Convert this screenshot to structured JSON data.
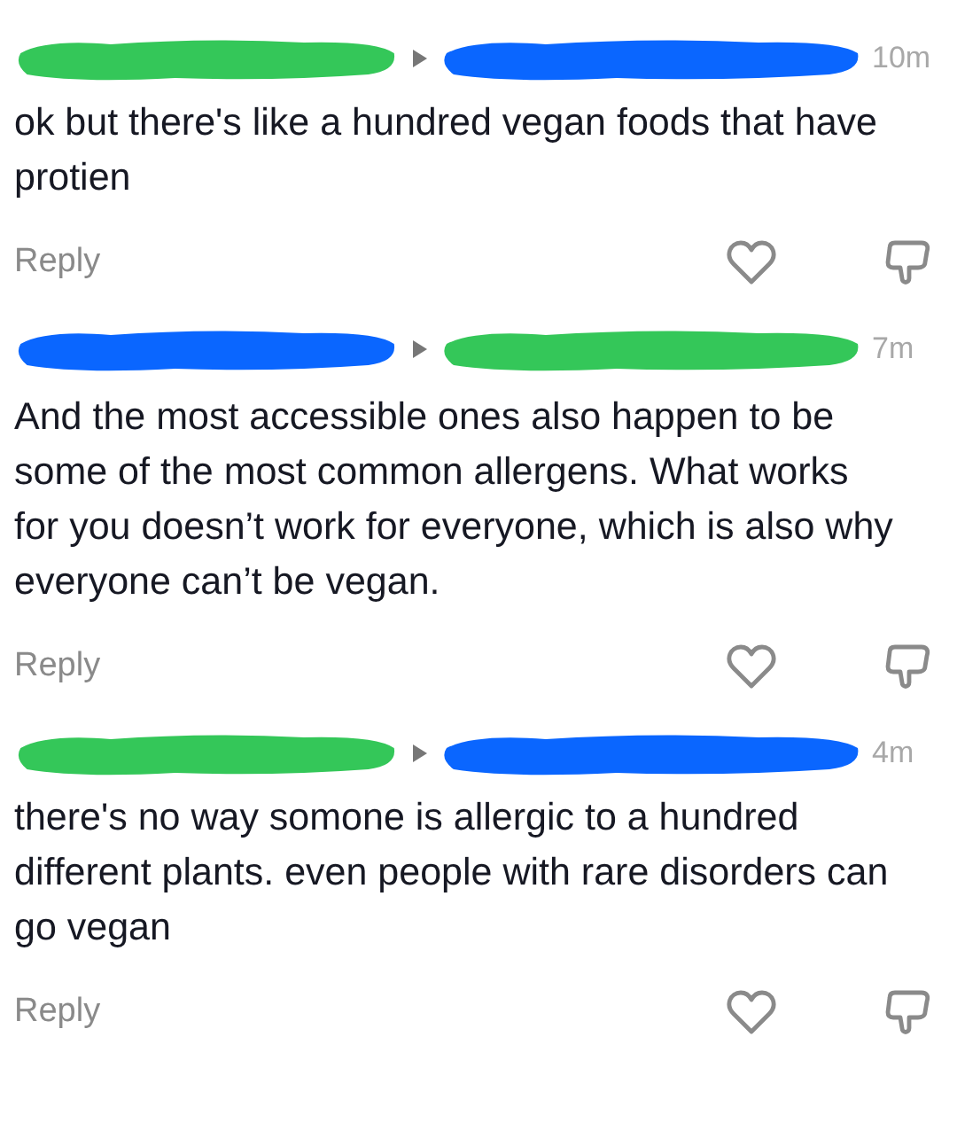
{
  "comments": [
    {
      "redactions": [
        {
          "color": "#34c759"
        },
        {
          "color": "#0a66ff"
        }
      ],
      "time": "10m",
      "text": "ok but there's like a hundred vegan foods that have protien",
      "reply": "Reply"
    },
    {
      "redactions": [
        {
          "color": "#0a66ff"
        },
        {
          "color": "#34c759"
        }
      ],
      "time": "7m",
      "text": "And the most accessible ones also happen to be some of the most common allergens. What works for you doesn’t work for everyone, which is also why everyone can’t be vegan.",
      "reply": "Reply"
    },
    {
      "redactions": [
        {
          "color": "#34c759"
        },
        {
          "color": "#0a66ff"
        }
      ],
      "time": "4m",
      "text": "there's no way somone is allergic to a hundred different plants. even people with rare disorders can go vegan",
      "reply": "Reply"
    }
  ]
}
